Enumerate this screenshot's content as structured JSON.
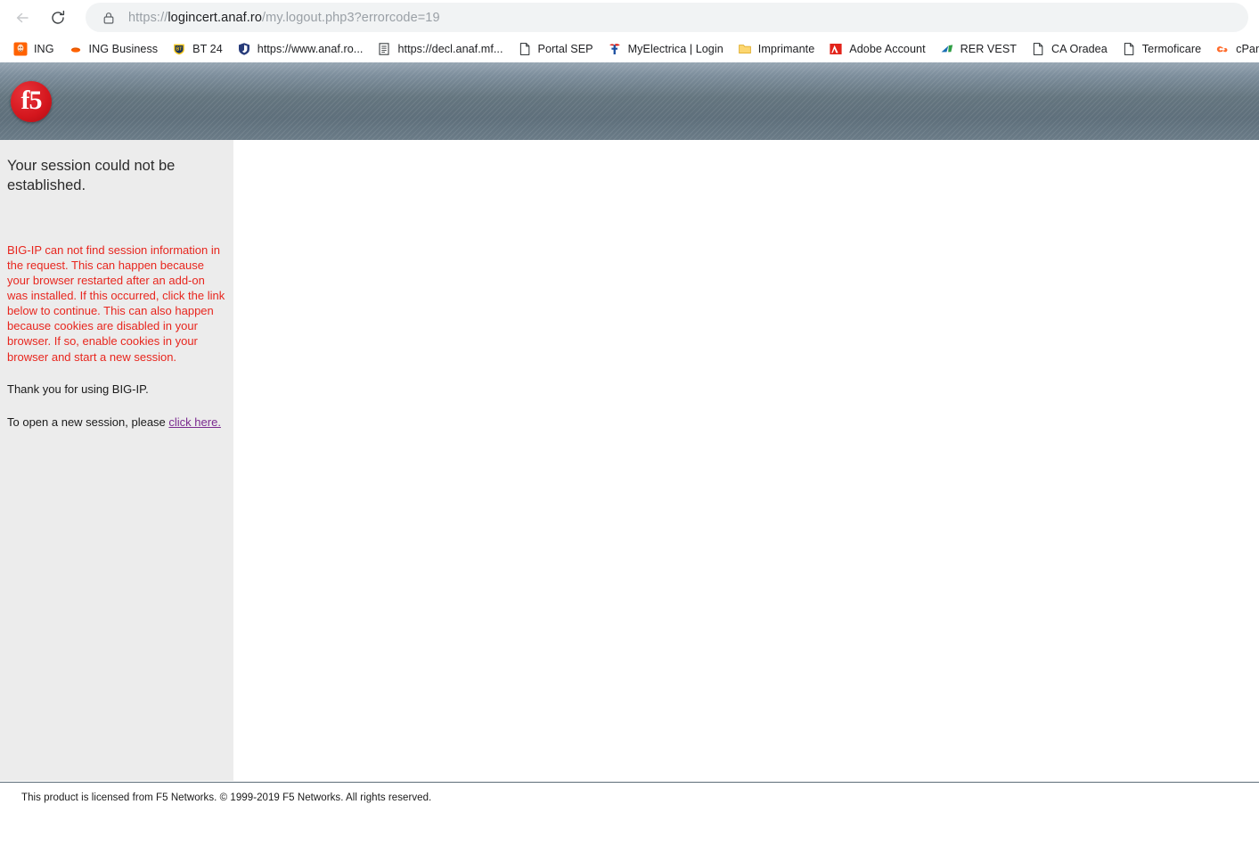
{
  "browser": {
    "back_label": "Back",
    "reload_label": "Reload",
    "url_scheme": "https://",
    "url_host": "logincert.anaf.ro",
    "url_path": "/my.logout.php3?errorcode=19",
    "url_full": "https://logincert.anaf.ro/my.logout.php3?errorcode=19",
    "lock_icon": "padlock-icon"
  },
  "bookmarks": [
    {
      "label": "ING",
      "icon": "ing-lion-icon"
    },
    {
      "label": "ING Business",
      "icon": "ing-business-icon"
    },
    {
      "label": "BT 24",
      "icon": "bt24-shield-icon"
    },
    {
      "label": "https://www.anaf.ro...",
      "icon": "blue-shield-icon"
    },
    {
      "label": "https://decl.anaf.mf...",
      "icon": "document-lines-icon"
    },
    {
      "label": "Portal SEP",
      "icon": "page-icon"
    },
    {
      "label": "MyElectrica | Login",
      "icon": "myelectrica-icon"
    },
    {
      "label": "Imprimante",
      "icon": "folder-icon"
    },
    {
      "label": "Adobe Account",
      "icon": "adobe-icon"
    },
    {
      "label": "RER VEST",
      "icon": "rer-vest-icon"
    },
    {
      "label": "CA Oradea",
      "icon": "page-icon"
    },
    {
      "label": "Termoficare",
      "icon": "page-icon"
    },
    {
      "label": "cPanel Login",
      "icon": "cpanel-icon"
    },
    {
      "label": "",
      "icon": "page-icon"
    }
  ],
  "header": {
    "logo_text": "f5",
    "logo_name": "f5-logo"
  },
  "content": {
    "title": "Your session could not be established.",
    "error_message": "BIG-IP can not find session information in the request. This can happen because your browser restarted after an add-on was installed. If this occurred, click the link below to continue. This can also happen because cookies are disabled in your browser. If so, enable cookies in your browser and start a new session.",
    "thanks": "Thank you for using BIG-IP.",
    "new_session_prefix": "To open a new session, please ",
    "new_session_link": "click here."
  },
  "footer": {
    "text": "This product is licensed from F5 Networks. © 1999-2019 F5 Networks. All rights reserved."
  },
  "colors": {
    "error_red": "#e8261e",
    "link_purple": "#7a2a8f",
    "panel_gray": "#ececec",
    "f5_red": "#d4161d",
    "header_blue_gray": "#64757f"
  }
}
